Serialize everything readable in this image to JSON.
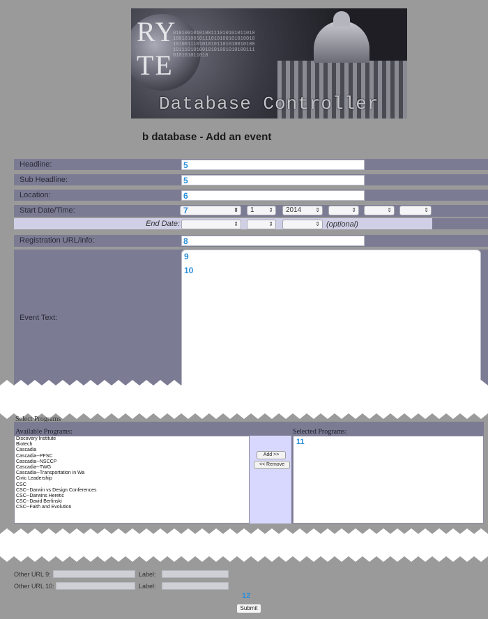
{
  "banner": {
    "big_text_1": "RY",
    "big_text_2": "TE",
    "title": "Database Controller"
  },
  "page_title": "b database - Add an event",
  "fields": {
    "headline": {
      "label": "Headline:",
      "value": "5"
    },
    "sub_headline": {
      "label": "Sub Headline:",
      "value": "5"
    },
    "location": {
      "label": "Location:",
      "value": "6"
    },
    "start": {
      "label": "Start Date/Time:",
      "month": "7",
      "day": "1",
      "year": "2014"
    },
    "end": {
      "label": "End Date:",
      "optional": "(optional)"
    },
    "registration": {
      "label": "Registration URL/info:",
      "value": "8"
    },
    "event_text": {
      "label": "Event Text:",
      "line1": "9",
      "line2": "10"
    }
  },
  "programs": {
    "section_label": "Select Programs",
    "available_label": "Available Programs:",
    "selected_label": "Selected Programs:",
    "available": [
      "Discovery Institute",
      "Biotech",
      "Cascadia",
      "Cascadia--PFSC",
      "Cascadia--NSCCP",
      "Cascadia--TWG",
      "Cascadia--Transportation in Wa",
      "Civic Leadership",
      "CSC",
      "CSC--Darwin vs Design Conferences",
      "CSC--Darwins Heretic",
      "CSC--David Berlinski",
      "CSC--Faith and Evolution"
    ],
    "selected_marker": "11",
    "add_label": "Add  >>",
    "remove_label": "<< Remove"
  },
  "bottom": {
    "url9_label": "Other URL 9:",
    "url9_label2": "Label:",
    "url10_label": "Other URL 10:",
    "url10_label2": "Label:",
    "marker": "12",
    "submit_label": "Submit"
  }
}
